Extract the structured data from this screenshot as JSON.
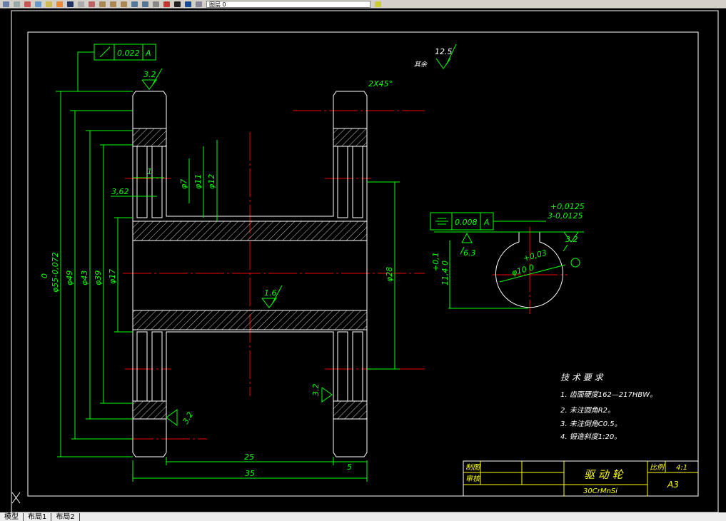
{
  "toolbar": {
    "layer_name": "图层 0",
    "icons": [
      "print-icon",
      "preview-icon",
      "cut-icon",
      "copy-icon",
      "paste-icon",
      "match-properties-icon",
      "undo-icon",
      "redo-icon",
      "pan-icon",
      "zoom-realtime-icon",
      "zoom-window-icon",
      "zoom-previous-icon",
      "properties-icon",
      "design-center-icon",
      "tool-palette-icon",
      "help-icon",
      "layer-manager-icon",
      "layer-state-icon"
    ]
  },
  "layout_tabs": [
    "模型",
    "布局1",
    "布局2"
  ],
  "colors": {
    "background": "#000000",
    "geometry": "#ffffff",
    "dimension": "#00ff00",
    "centerline": "#ff0000",
    "text": "#ffffff",
    "titleblock": "#ffff00"
  },
  "drawing": {
    "gdt_runout": {
      "value": "0.022",
      "datum": "A"
    },
    "gdt_symmetry": {
      "value": "0.008",
      "datum": "A"
    },
    "roughness": {
      "top": "3.2",
      "general": "12.5",
      "general_label": "其余",
      "bore": "1.6",
      "flange": "3.2",
      "groove": "3.2",
      "keyway_bottom": "6.3",
      "keyway_side": "3.2"
    },
    "chamfer": "2X45°",
    "dims": {
      "d55": "φ55-0,072",
      "d55_upper": "0",
      "d49": "φ49",
      "d43": "φ43",
      "d39": "φ39",
      "d17": "φ17",
      "d7": "φ7",
      "d11": "φ11",
      "d12": "φ12",
      "w362": "3,62",
      "w1": "1",
      "d28": "φ28",
      "l25": "25",
      "l35": "35",
      "l5": "5",
      "key_w_upper": "+0,0125",
      "key_w": "3-0,0125",
      "key_h_upper": "+0,1",
      "key_h": "11,4 0",
      "bore_upper": "+0,03",
      "bore": "φ10 0"
    },
    "tech_req": {
      "title": "技   术   要   求",
      "items": [
        "1. 齿面硬度162—217HBW。",
        "2. 未注圆角R2。",
        "3. 未注倒角C0.5。",
        "4. 锻造斜度1:20。"
      ]
    },
    "title_block": {
      "drawn_label": "制图",
      "checked_label": "审核",
      "part_name": "驱 动 轮",
      "material": "30CrMnSi",
      "scale_label": "比例",
      "scale": "4:1",
      "sheet": "A3"
    }
  }
}
